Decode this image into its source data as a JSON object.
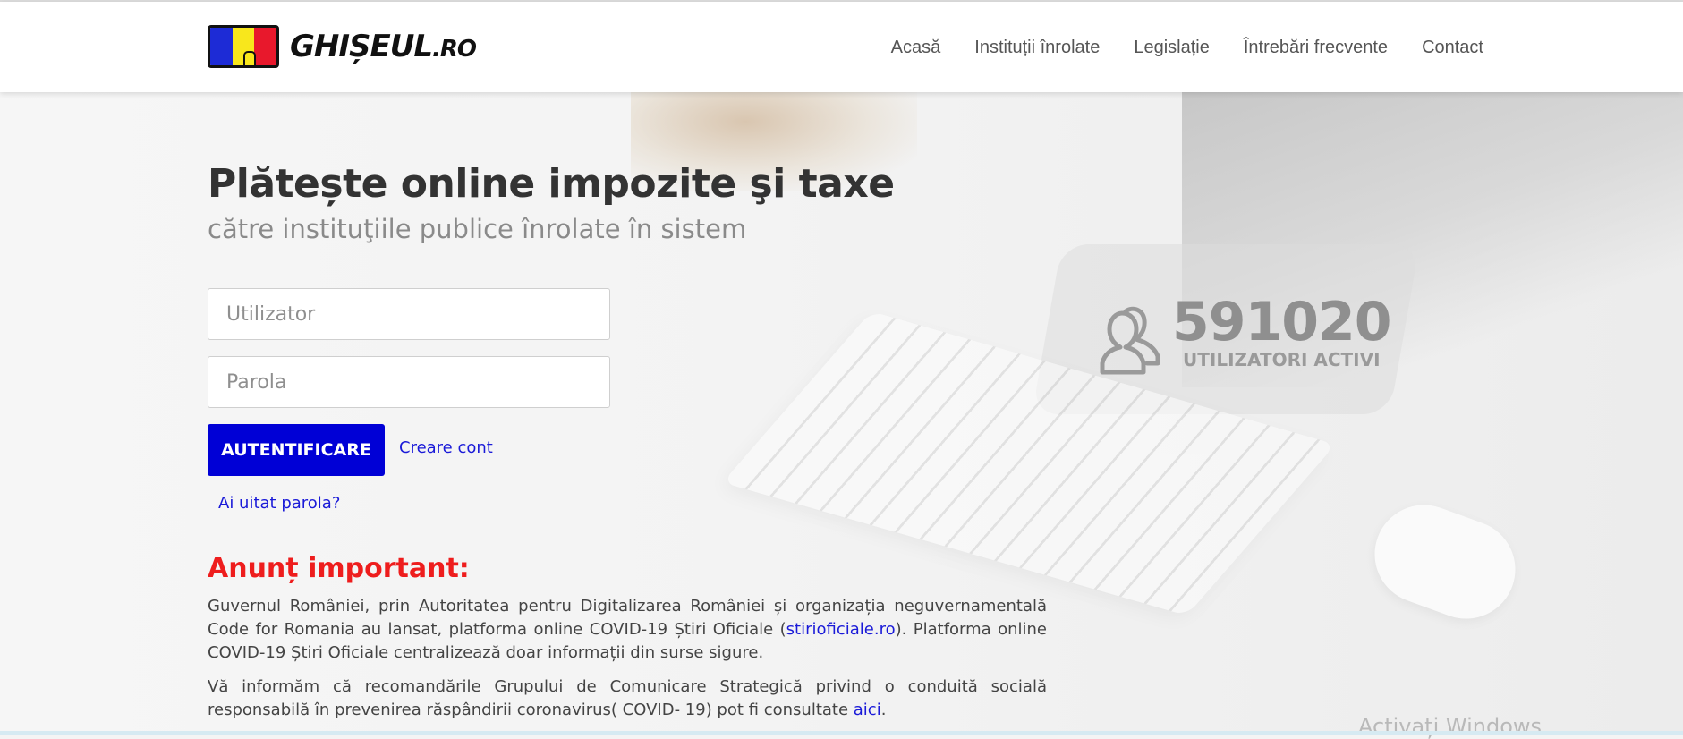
{
  "logo": {
    "text": "GHIȘEUL",
    "suffix": ".RO",
    "flag_colors": [
      "#1d2bd6",
      "#f8e71c",
      "#e8182c"
    ]
  },
  "nav": {
    "items": [
      {
        "label": "Acasă"
      },
      {
        "label": "Instituții înrolate"
      },
      {
        "label": "Legislație"
      },
      {
        "label": "Întrebări frecvente"
      },
      {
        "label": "Contact"
      }
    ]
  },
  "hero": {
    "title": "Plătește online impozite şi taxe",
    "subtitle": "către instituţiile publice înrolate în sistem"
  },
  "login": {
    "username_placeholder": "Utilizator",
    "password_placeholder": "Parola",
    "submit_label": "AUTENTIFICARE",
    "create_account_label": "Creare cont",
    "forgot_password_label": "Ai uitat parola?"
  },
  "stats": {
    "count": "591020",
    "label": "UTILIZATORI ACTIVI",
    "icon": "users-icon"
  },
  "announcement": {
    "title": "Anunț important:",
    "p1_before": "Guvernul României, prin Autoritatea pentru Digitalizarea României și organizația neguvernamentală Code for Romania au lansat, platforma online COVID-19 Știri Oficiale (",
    "p1_link": "stirioficiale.ro",
    "p1_after": "). Platforma online COVID-19 Știri Oficiale centralizează doar informații din surse sigure.",
    "p2_before": "Vă informăm că recomandările Grupului de Comunicare Strategică privind o conduită socială responsabilă în prevenirea răspândirii coronavirus( COVID- 19) pot fi consultate ",
    "p2_link": "aici",
    "p2_after": "."
  },
  "watermark": "Activați Windows",
  "colors": {
    "primary_button": "#0000d6",
    "link": "#1a1ad8",
    "alert_title": "#ee1d1d"
  }
}
